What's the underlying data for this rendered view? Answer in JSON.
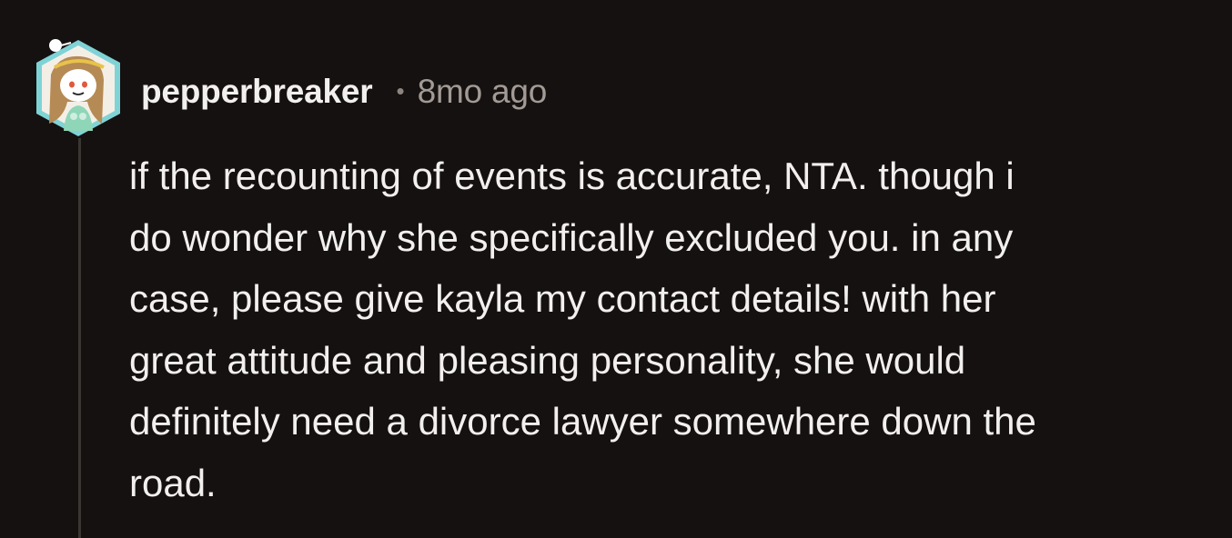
{
  "comment": {
    "author": "pepperbreaker",
    "separator": "•",
    "time_ago": "8mo ago",
    "avatar_icon": "snoo-avatar-icon",
    "body_lines": [
      "if the recounting of events is accurate, NTA. though i",
      "do wonder why she specifically excluded you. in any",
      "case, please give kayla my contact details! with her",
      "great attitude and pleasing personality, she would",
      "definitely need a divorce lawyer somewhere down the",
      "road."
    ]
  },
  "colors": {
    "background": "#151110",
    "text": "#f2f0ef",
    "muted": "#a29a95",
    "thread_line": "#3a3634",
    "avatar_frame": "#7fd3d6"
  }
}
